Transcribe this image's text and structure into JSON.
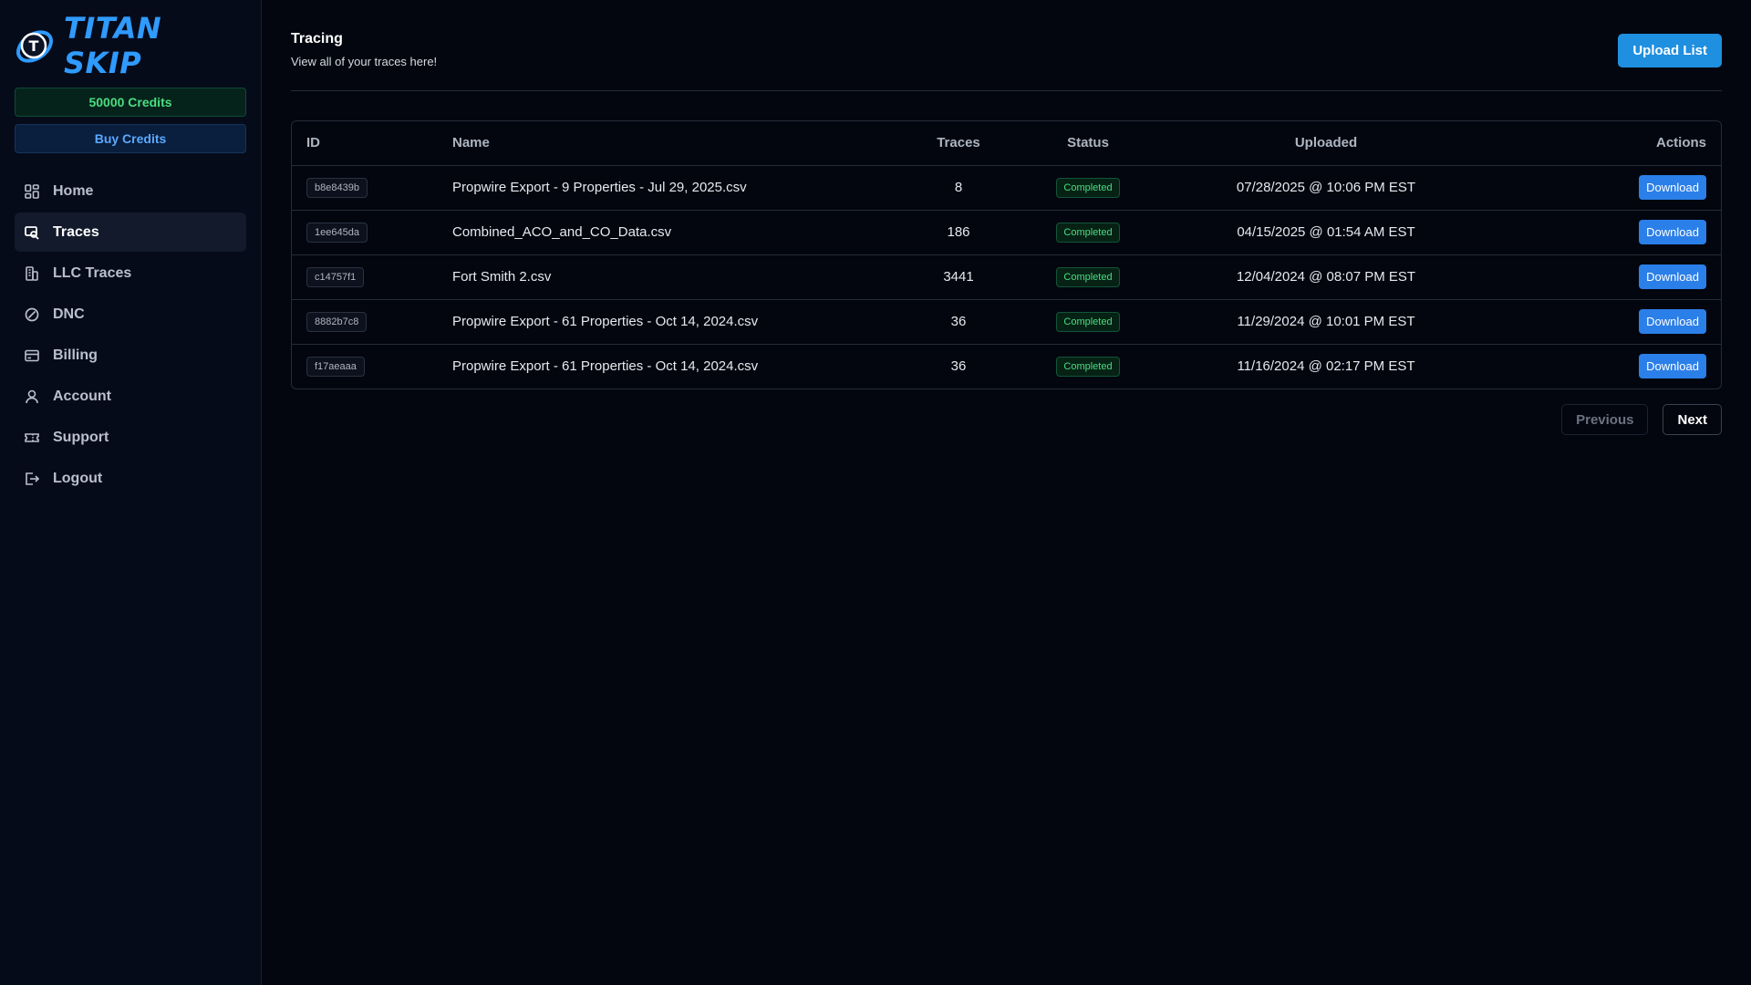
{
  "brand": {
    "name": "TITAN SKIP",
    "logo_letter": "T"
  },
  "sidebar": {
    "credits_label": "50000 Credits",
    "buy_credits_label": "Buy Credits",
    "items": [
      {
        "label": "Home",
        "icon": "grid-icon"
      },
      {
        "label": "Traces",
        "icon": "search-icon",
        "active": true
      },
      {
        "label": "LLC Traces",
        "icon": "building-icon"
      },
      {
        "label": "DNC",
        "icon": "ban-icon"
      },
      {
        "label": "Billing",
        "icon": "credit-card-icon"
      },
      {
        "label": "Account",
        "icon": "user-icon"
      },
      {
        "label": "Support",
        "icon": "ticket-icon"
      },
      {
        "label": "Logout",
        "icon": "logout-icon"
      }
    ]
  },
  "header": {
    "title": "Tracing",
    "subtitle": "View all of your traces here!",
    "upload_label": "Upload List"
  },
  "table": {
    "columns": [
      "ID",
      "Name",
      "Traces",
      "Status",
      "Uploaded",
      "Actions"
    ],
    "rows": [
      {
        "id": "b8e8439b",
        "name": "Propwire Export - 9 Properties - Jul 29, 2025.csv",
        "traces": "8",
        "status": "Completed",
        "uploaded": "07/28/2025 @ 10:06 PM EST",
        "action": "Download"
      },
      {
        "id": "1ee645da",
        "name": "Combined_ACO_and_CO_Data.csv",
        "traces": "186",
        "status": "Completed",
        "uploaded": "04/15/2025 @ 01:54 AM EST",
        "action": "Download"
      },
      {
        "id": "c14757f1",
        "name": "Fort Smith 2.csv",
        "traces": "3441",
        "status": "Completed",
        "uploaded": "12/04/2024 @ 08:07 PM EST",
        "action": "Download"
      },
      {
        "id": "8882b7c8",
        "name": "Propwire Export - 61 Properties - Oct 14, 2024.csv",
        "traces": "36",
        "status": "Completed",
        "uploaded": "11/29/2024 @ 10:01 PM EST",
        "action": "Download"
      },
      {
        "id": "f17aeaaa",
        "name": "Propwire Export - 61 Properties - Oct 14, 2024.csv",
        "traces": "36",
        "status": "Completed",
        "uploaded": "11/16/2024 @ 02:17 PM EST",
        "action": "Download"
      }
    ]
  },
  "pagination": {
    "previous_label": "Previous",
    "next_label": "Next"
  },
  "colors": {
    "accent": "#1f8fe0",
    "success": "#4ade80",
    "background": "#03060f",
    "sidebar": "#060b1a"
  }
}
